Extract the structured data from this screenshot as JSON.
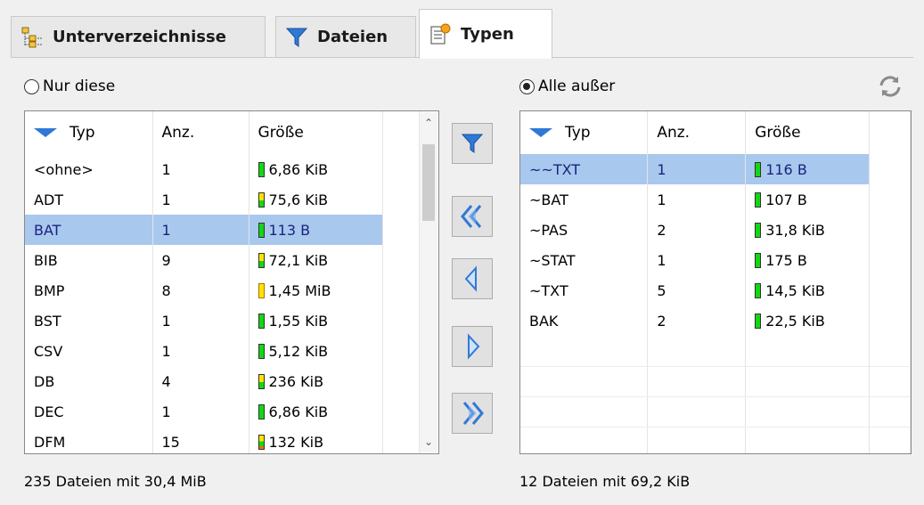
{
  "tabs": [
    {
      "label": "Unterverzeichnisse"
    },
    {
      "label": "Dateien"
    },
    {
      "label": "Typen"
    }
  ],
  "left": {
    "radio_label": "Nur diese",
    "radio_selected": false,
    "headers": {
      "type": "Typ",
      "count": "Anz.",
      "size": "Größe"
    },
    "rows": [
      {
        "type": "<ohne>",
        "count": "1",
        "size": "6,86 KiB",
        "bar": "green"
      },
      {
        "type": "ADT",
        "count": "1",
        "size": "75,6 KiB",
        "bar": "yg"
      },
      {
        "type": "BAT",
        "count": "1",
        "size": "113 B",
        "bar": "green",
        "selected": true
      },
      {
        "type": "BIB",
        "count": "9",
        "size": "72,1 KiB",
        "bar": "yg"
      },
      {
        "type": "BMP",
        "count": "8",
        "size": "1,45 MiB",
        "bar": "yellow"
      },
      {
        "type": "BST",
        "count": "1",
        "size": "1,55 KiB",
        "bar": "green"
      },
      {
        "type": "CSV",
        "count": "1",
        "size": "5,12 KiB",
        "bar": "green"
      },
      {
        "type": "DB",
        "count": "4",
        "size": "236 KiB",
        "bar": "yg"
      },
      {
        "type": "DEC",
        "count": "1",
        "size": "6,86 KiB",
        "bar": "green"
      },
      {
        "type": "DFM",
        "count": "15",
        "size": "132 KiB",
        "bar": "ygr"
      }
    ],
    "status": "235 Dateien mit 30,4 MiB"
  },
  "right": {
    "radio_label": "Alle außer",
    "radio_selected": true,
    "headers": {
      "type": "Typ",
      "count": "Anz.",
      "size": "Größe"
    },
    "rows": [
      {
        "type": "~~TXT",
        "count": "1",
        "size": "116 B",
        "bar": "green",
        "selected": true
      },
      {
        "type": "~BAT",
        "count": "1",
        "size": "107 B",
        "bar": "green"
      },
      {
        "type": "~PAS",
        "count": "2",
        "size": "31,8 KiB",
        "bar": "green"
      },
      {
        "type": "~STAT",
        "count": "1",
        "size": "175 B",
        "bar": "green"
      },
      {
        "type": "~TXT",
        "count": "5",
        "size": "14,5 KiB",
        "bar": "green"
      },
      {
        "type": "BAK",
        "count": "2",
        "size": "22,5 KiB",
        "bar": "green"
      }
    ],
    "status": "12 Dateien mit 69,2 KiB"
  },
  "middle_buttons": [
    {
      "icon": "filter-icon"
    },
    {
      "icon": "double-left-arrow-icon"
    },
    {
      "icon": "left-arrow-icon"
    },
    {
      "icon": "right-arrow-icon"
    },
    {
      "icon": "double-right-arrow-icon"
    }
  ],
  "colors": {
    "selection": "#a9c8ee",
    "accent": "#2f79d6",
    "bar_green": "#12d812",
    "bar_yellow": "#ffe400"
  }
}
